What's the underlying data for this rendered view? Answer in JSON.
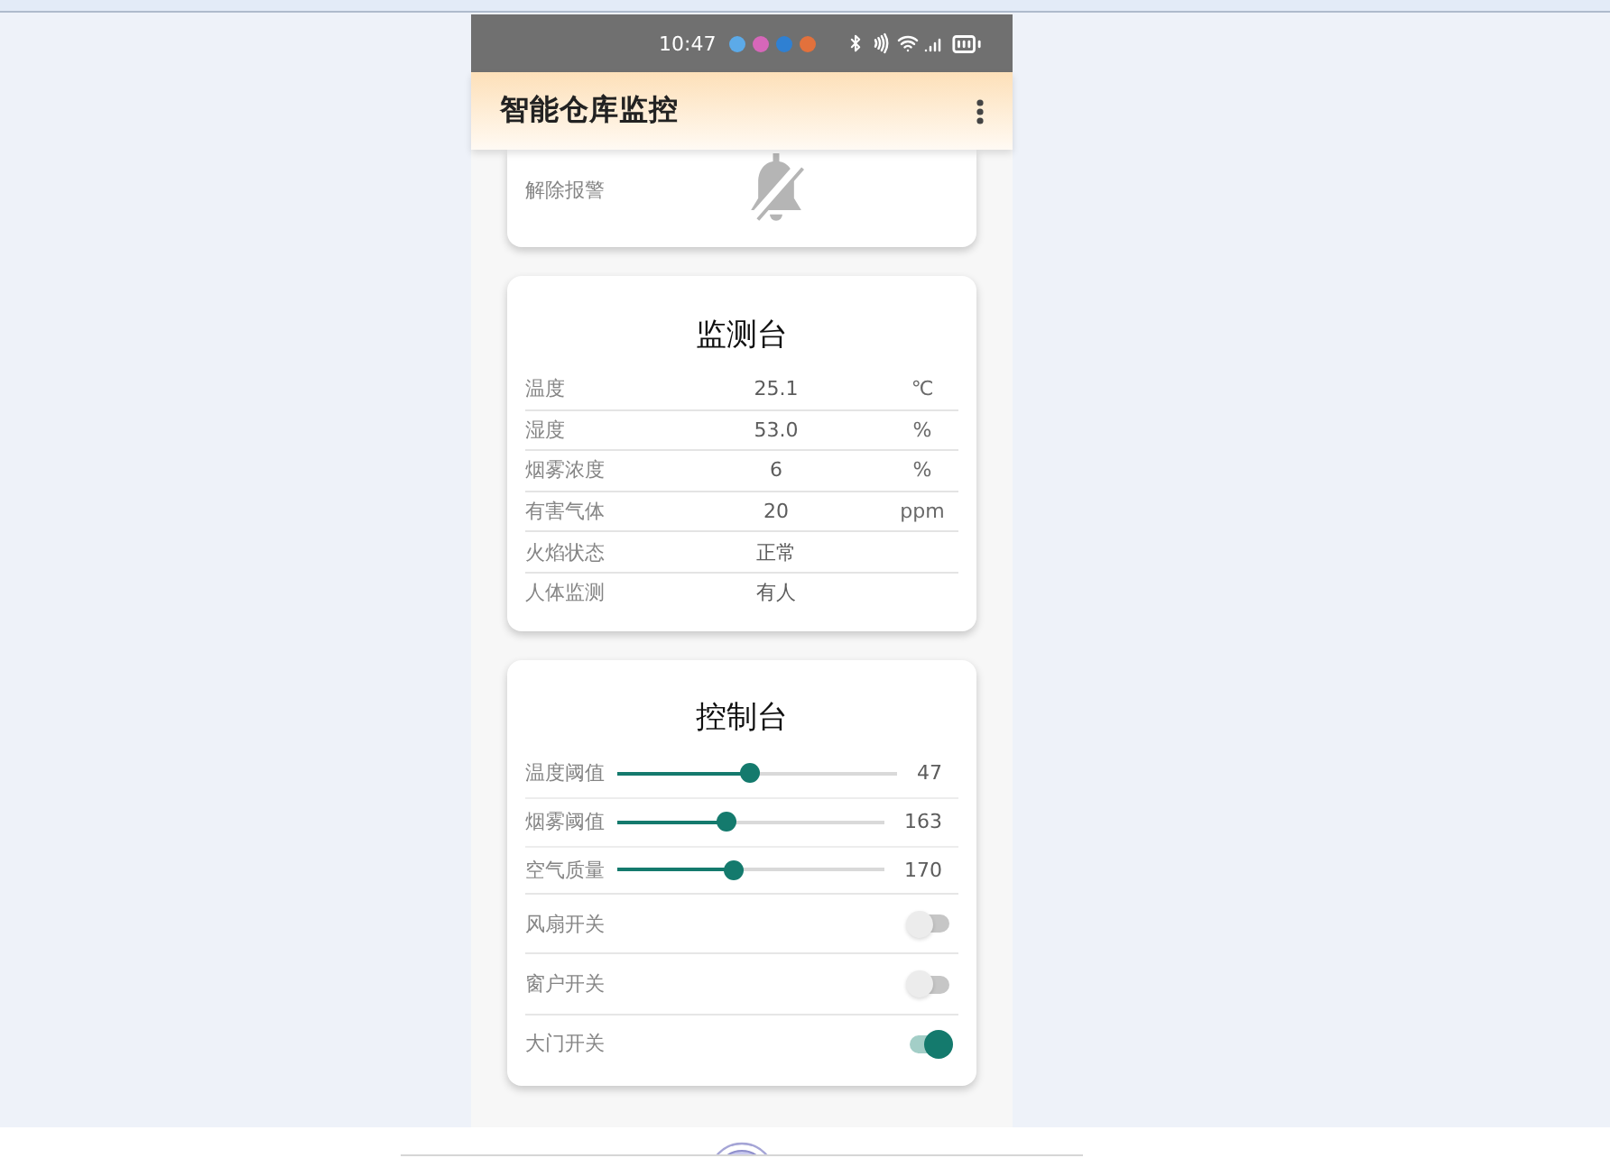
{
  "status_bar": {
    "time": "10:47"
  },
  "app_bar": {
    "title": "智能仓库监控"
  },
  "alarm_card": {
    "label": "解除报警"
  },
  "monitor": {
    "title": "监测台",
    "rows": [
      {
        "label": "温度",
        "value": "25.1",
        "unit": "℃"
      },
      {
        "label": "湿度",
        "value": "53.0",
        "unit": "%"
      },
      {
        "label": "烟雾浓度",
        "value": "6",
        "unit": "%"
      },
      {
        "label": "有害气体",
        "value": "20",
        "unit": "ppm"
      },
      {
        "label": "火焰状态",
        "value": "正常"
      },
      {
        "label": "人体监测",
        "value": "有人"
      }
    ]
  },
  "control": {
    "title": "控制台",
    "items": [
      {
        "kind": "slider",
        "label": "温度阈值",
        "level": 0.47,
        "reading": "47"
      },
      {
        "kind": "slider",
        "label": "烟雾阈值",
        "level": 0.4,
        "reading": "163"
      },
      {
        "kind": "slider",
        "label": "空气质量",
        "level": 0.43,
        "reading": "170"
      },
      {
        "kind": "switch",
        "label": "风扇开关",
        "on": false
      },
      {
        "kind": "switch",
        "label": "窗户开关",
        "on": false
      },
      {
        "kind": "switch",
        "label": "大门开关",
        "on": true
      }
    ]
  }
}
